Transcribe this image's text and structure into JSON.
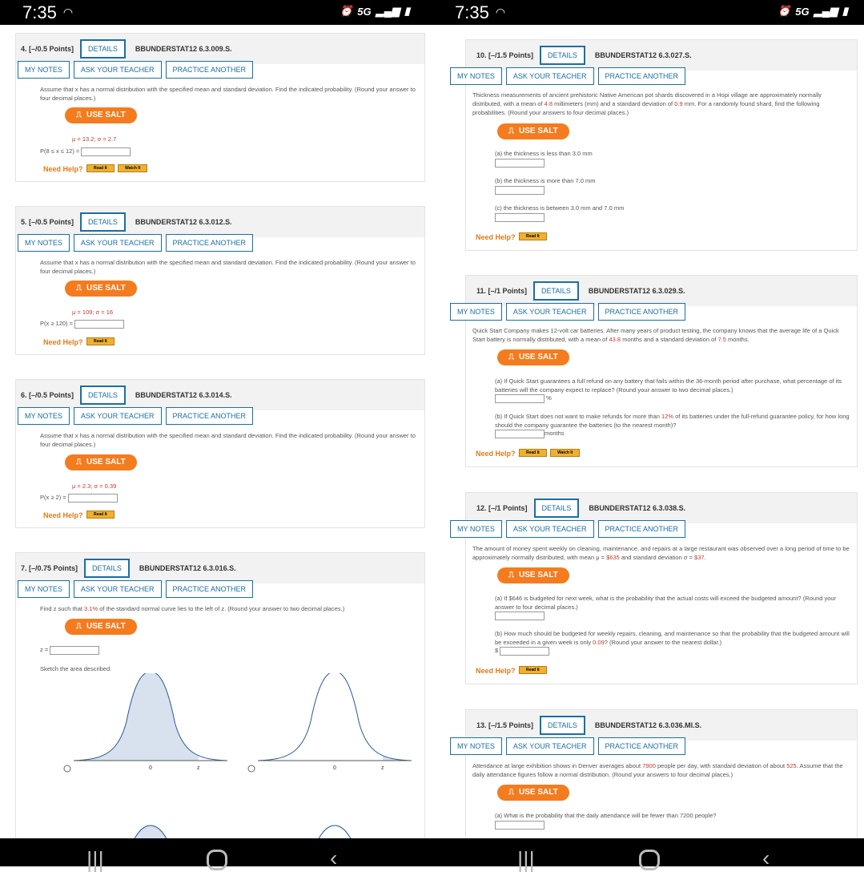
{
  "status_left": {
    "time": "7:35",
    "network": "5G"
  },
  "status_right": {
    "time": "7:35",
    "network": "5G"
  },
  "buttons": {
    "details": "DETAILS",
    "notes": "MY NOTES",
    "ask": "ASK YOUR TEACHER",
    "practice": "PRACTICE ANOTHER",
    "salt": "USE SALT",
    "help": "Need Help?",
    "read": "Read It",
    "watch": "Watch It"
  },
  "q4": {
    "num": "4. [–/0.5 Points]",
    "code": "BBUNDERSTAT12 6.3.009.S.",
    "text": "Assume that x has a normal distribution with the specified mean and standard deviation. Find the indicated probability. (Round your answer to four decimal places.)",
    "params": "μ = 13.2; σ = 2.7",
    "prob": "P(8 ≤ x ≤ 12) ="
  },
  "q5": {
    "num": "5. [–/0.5 Points]",
    "code": "BBUNDERSTAT12 6.3.012.S.",
    "text": "Assume that x has a normal distribution with the specified mean and standard deviation. Find the indicated probability. (Round your answer to four decimal places.)",
    "params": "μ = 109; σ = 16",
    "prob": "P(x ≥ 120) ="
  },
  "q6": {
    "num": "6. [–/0.5 Points]",
    "code": "BBUNDERSTAT12 6.3.014.S.",
    "text": "Assume that x has a normal distribution with the specified mean and standard deviation. Find the indicated probability. (Round your answer to four decimal places.)",
    "params": "μ = 2.3; σ = 0.39",
    "prob": "P(x ≥ 2) ="
  },
  "q7": {
    "num": "7. [–/0.75 Points]",
    "code": "BBUNDERSTAT12 6.3.016.S.",
    "text_a": "Find z such that ",
    "pct": "3.1%",
    "text_b": " of the standard normal curve lies to the left of z. (Round your answer to two decimal places.)",
    "zlabel": "z =",
    "sketch": "Sketch the area described.",
    "zero": "0",
    "z": "z"
  },
  "q10": {
    "num": "10. [–/1.5 Points]",
    "code": "BBUNDERSTAT12 6.3.027.S.",
    "text_a": "Thickness measurements of ancient prehistoric Native American pot shards discovered in a Hopi village are approximately normally distributed, with a mean of ",
    "mean": "4.8",
    "text_b": " millimeters (mm) and a standard deviation of ",
    "sd": "0.9",
    "text_c": " mm. For a randomly found shard, find the following probabilities. (Round your answers to four decimal places.)",
    "a": "(a) the thickness is less than 3.0 mm",
    "b": "(b) the thickness is more than 7.0 mm",
    "c": "(c) the thickness is between 3.0 mm and 7.0 mm"
  },
  "q11": {
    "num": "11. [–/1 Points]",
    "code": "BBUNDERSTAT12 6.3.029.S.",
    "text_a": "Quick Start Company makes 12-volt car batteries. After many years of product testing, the company knows that the average life of a Quick Start battery is normally distributed, with a mean of ",
    "mean": "43.8",
    "text_b": " months and a standard deviation of ",
    "sd": "7.5",
    "text_c": " months.",
    "a": "(a) If Quick Start guarantees a full refund on any battery that fails within the 36-month period after purchase, what percentage of its batteries will the company expect to replace? (Round your answer to two decimal places.)",
    "a_unit": "%",
    "b_a": "(b) If Quick Start does not want to make refunds for more than ",
    "b_pct": "12%",
    "b_b": " of its batteries under the full-refund guarantee policy, for how long should the company guarantee the batteries (to the nearest month)?",
    "b_unit": "months"
  },
  "q12": {
    "num": "12. [–/1 Points]",
    "code": "BBUNDERSTAT12 6.3.038.S.",
    "text_a": "The amount of money spent weekly on cleaning, maintenance, and repairs at a large restaurant was observed over a long period of time to be approximately normally distributed, with mean μ = ",
    "mean": "$635",
    "text_b": " and standard deviation σ = ",
    "sd": "$37",
    "text_c": ".",
    "a": "(a) If $646 is budgeted for next week, what is the probability that the actual costs will exceed the budgeted amount? (Round your answer to four decimal places.)",
    "b_a": "(b) How much should be budgeted for weekly repairs, cleaning, and maintenance so that the probability that the budgeted amount will be exceeded in a given week is only ",
    "b_val": "0.09",
    "b_b": "? (Round your answer to the nearest dollar.)",
    "dollar": "$"
  },
  "q13": {
    "num": "13. [–/1.5 Points]",
    "code": "BBUNDERSTAT12 6.3.036.MI.S.",
    "text_a": "Attendance at large exhibition shows in Denver averages about ",
    "mean": "7900",
    "text_b": " people per day, with standard deviation of about ",
    "sd": "525",
    "text_c": ". Assume that the daily attendance figures follow a normal distribution. (Round your answers to four decimal places.)",
    "a": "(a) What is the probability that the daily attendance will be fewer than 7200 people?"
  }
}
